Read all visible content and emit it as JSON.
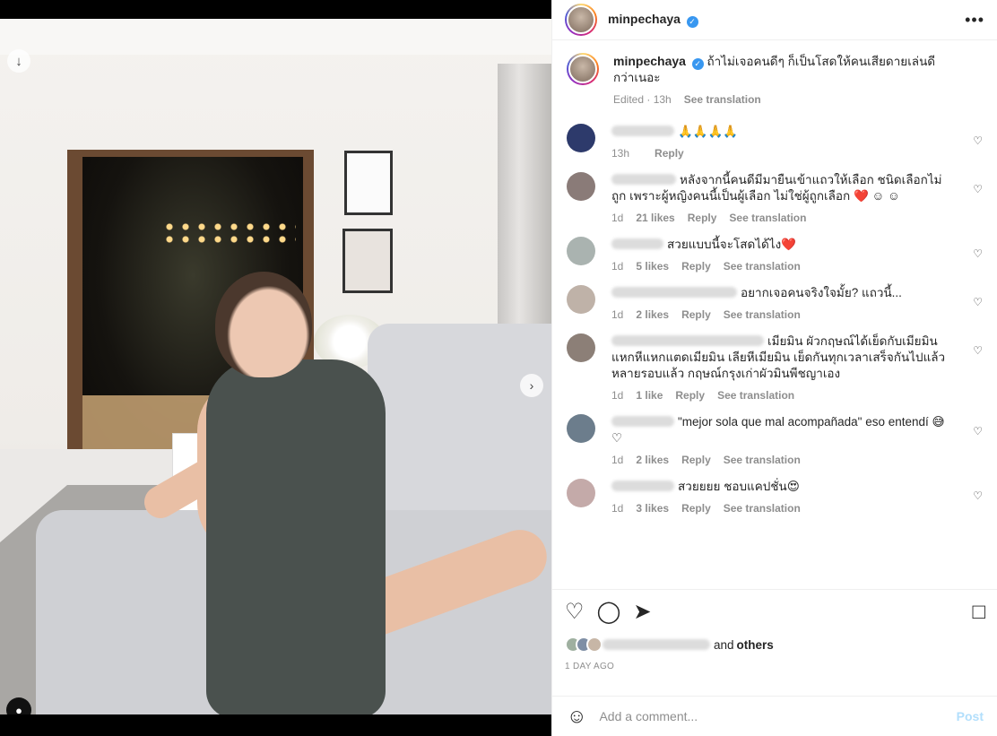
{
  "post": {
    "username": "minpechaya",
    "caption": "ถ้าไม่เจอคนดีๆ ก็เป็นโสดให้คนเสียดายเล่นดีกว่าเนอะ",
    "caption_meta_edited": "Edited · 13h",
    "caption_meta_translate": "See translation",
    "more_icon": "more-horizontal-icon",
    "verified_icon": "verified-badge-icon"
  },
  "media": {
    "download_icon": "arrow-down-icon",
    "next_icon": "chevron-right-icon",
    "tag_icon": "user-tag-icon",
    "slide_count": 4,
    "active_slide": 1
  },
  "comments": [
    {
      "text": "🙏🙏🙏🙏",
      "time": "13h",
      "likes": "",
      "reply": "Reply",
      "translate": "",
      "avatar_color": "#2d3a6b",
      "name_w": 70
    },
    {
      "text": "หลังจากนี้คนดีมีมายืนเข้าแถวให้เลือก ชนิดเลือกไม่ถูก เพราะผู้หญิงคนนี้เป็นผู้เลือก ไม่ใช่ผู้ถูกเลือก ❤️ ☺ ☺",
      "time": "1d",
      "likes": "21 likes",
      "reply": "Reply",
      "translate": "See translation",
      "avatar_color": "#8a7b78",
      "name_w": 72
    },
    {
      "text": "สวยแบบนี้จะโสดได้ไง❤️",
      "time": "1d",
      "likes": "5 likes",
      "reply": "Reply",
      "translate": "See translation",
      "avatar_color": "#aab3b0",
      "name_w": 58
    },
    {
      "text": "อยากเจอคนจริงใจมั้ย? แถวนี้...",
      "time": "1d",
      "likes": "2 likes",
      "reply": "Reply",
      "translate": "See translation",
      "avatar_color": "#bfb2a8",
      "name_w": 140
    },
    {
      "text": "เมียมิน ผัวกฤษณ์ได้เย็ดกับเมียมิน แหกหีแหกแตดเมียมิน เลียหีเมียมิน เย็ดกันทุกเวลาเสร็จกันไปแล้วหลายรอบแล้ว กฤษณ์กรุงเก่าผัวมินพีชญาเอง",
      "time": "1d",
      "likes": "1 like",
      "reply": "Reply",
      "translate": "See translation",
      "avatar_color": "#8c7f77",
      "name_w": 170
    },
    {
      "text": "\"mejor sola que mal acompañada\" eso entendí 😅 ♡",
      "time": "1d",
      "likes": "2 likes",
      "reply": "Reply",
      "translate": "See translation",
      "avatar_color": "#6c7d8c",
      "name_w": 70
    },
    {
      "text": "สวยยยย ชอบแคปชั่น😍",
      "time": "1d",
      "likes": "3 likes",
      "reply": "Reply",
      "translate": "See translation",
      "avatar_color": "#c4aaa9",
      "name_w": 70
    }
  ],
  "actions": {
    "like_icon": "heart-icon",
    "comment_icon": "comment-icon",
    "share_icon": "send-icon",
    "save_icon": "bookmark-icon",
    "likes_suffix": "and",
    "likes_others": "others",
    "timestamp": "1 DAY AGO"
  },
  "add_comment": {
    "placeholder": "Add a comment...",
    "post_label": "Post",
    "emoji_icon": "emoji-icon"
  },
  "colors": {
    "verified": "#3897f0",
    "post_button_disabled": "#b2dffc",
    "meta_gray": "#8e8e8e",
    "text": "#262626"
  }
}
